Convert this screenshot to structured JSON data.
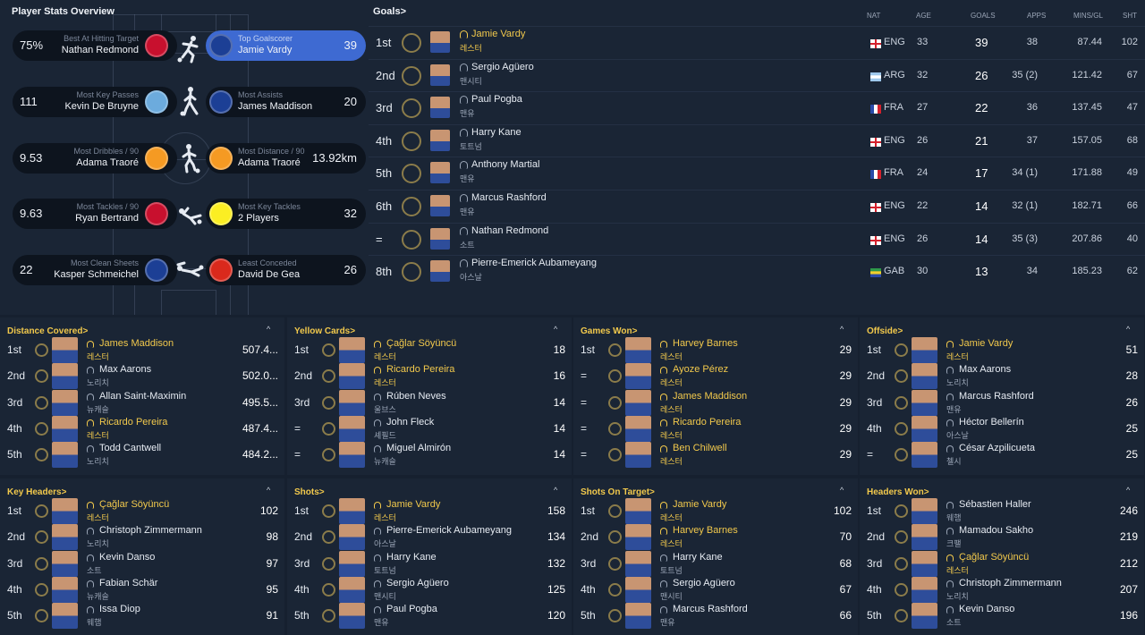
{
  "overview": {
    "title": "Player Stats Overview",
    "pills": [
      {
        "side": "left",
        "value": "75%",
        "sub": "Best At Hitting Target",
        "name": "Nathan Redmond",
        "crest": "#c8102e",
        "active": false
      },
      {
        "side": "right",
        "value": "39",
        "sub": "Top Goalscorer",
        "name": "Jamie Vardy",
        "crest": "#1c3f95",
        "active": true
      },
      {
        "side": "left",
        "value": "111",
        "sub": "Most Key Passes",
        "name": "Kevin De Bruyne",
        "crest": "#6cabdd",
        "active": false
      },
      {
        "side": "right",
        "value": "20",
        "sub": "Most Assists",
        "name": "James Maddison",
        "crest": "#1c3f95",
        "active": false
      },
      {
        "side": "left",
        "value": "9.53",
        "sub": "Most Dribbles / 90",
        "name": "Adama Traoré",
        "crest": "#f59a23",
        "active": false
      },
      {
        "side": "right",
        "value": "13.92km",
        "sub": "Most Distance / 90",
        "name": "Adama Traoré",
        "crest": "#f59a23",
        "active": false
      },
      {
        "side": "left",
        "value": "9.63",
        "sub": "Most Tackles / 90",
        "name": "Ryan Bertrand",
        "crest": "#c8102e",
        "active": false
      },
      {
        "side": "right",
        "value": "32",
        "sub": "Most Key Tackles",
        "name": "2 Players",
        "crest": "#fbee23",
        "active": false
      },
      {
        "side": "left",
        "value": "22",
        "sub": "Most Clean Sheets",
        "name": "Kasper Schmeichel",
        "crest": "#1c3f95",
        "active": false
      },
      {
        "side": "right",
        "value": "26",
        "sub": "Least Conceded",
        "name": "David De Gea",
        "crest": "#da291c",
        "active": false
      }
    ]
  },
  "goals": {
    "title": "Goals",
    "headers": {
      "nat": "NAT",
      "age": "AGE",
      "goals": "GOALS",
      "apps": "APPS",
      "mins": "MINS/GL",
      "sht": "SHT"
    },
    "rows": [
      {
        "pos": "1st",
        "name": "Jamie Vardy",
        "club": "레스터",
        "nat": "ENG",
        "flag": "eng",
        "age": "33",
        "goals": "39",
        "apps": "38",
        "mins": "87.44",
        "sht": "102",
        "hl": true
      },
      {
        "pos": "2nd",
        "name": "Sergio Agüero",
        "club": "맨시티",
        "nat": "ARG",
        "flag": "arg",
        "age": "32",
        "goals": "26",
        "apps": "35 (2)",
        "mins": "121.42",
        "sht": "67",
        "hl": false
      },
      {
        "pos": "3rd",
        "name": "Paul Pogba",
        "club": "맨유",
        "nat": "FRA",
        "flag": "fra",
        "age": "27",
        "goals": "22",
        "apps": "36",
        "mins": "137.45",
        "sht": "47",
        "hl": false
      },
      {
        "pos": "4th",
        "name": "Harry Kane",
        "club": "토트넘",
        "nat": "ENG",
        "flag": "eng",
        "age": "26",
        "goals": "21",
        "apps": "37",
        "mins": "157.05",
        "sht": "68",
        "hl": false
      },
      {
        "pos": "5th",
        "name": "Anthony Martial",
        "club": "맨유",
        "nat": "FRA",
        "flag": "fra",
        "age": "24",
        "goals": "17",
        "apps": "34 (1)",
        "mins": "171.88",
        "sht": "49",
        "hl": false
      },
      {
        "pos": "6th",
        "name": "Marcus Rashford",
        "club": "맨유",
        "nat": "ENG",
        "flag": "eng",
        "age": "22",
        "goals": "14",
        "apps": "32 (1)",
        "mins": "182.71",
        "sht": "66",
        "hl": false
      },
      {
        "pos": "=",
        "name": "Nathan Redmond",
        "club": "소트",
        "nat": "ENG",
        "flag": "eng",
        "age": "26",
        "goals": "14",
        "apps": "35 (3)",
        "mins": "207.86",
        "sht": "40",
        "hl": false
      },
      {
        "pos": "8th",
        "name": "Pierre-Emerick Aubameyang",
        "club": "아스날",
        "nat": "GAB",
        "flag": "gab",
        "age": "30",
        "goals": "13",
        "apps": "34",
        "mins": "185.23",
        "sht": "62",
        "hl": false
      }
    ]
  },
  "panels": [
    {
      "title": "Distance Covered",
      "rows": [
        {
          "rank": "1st",
          "name": "James Maddison",
          "club": "레스터",
          "value": "507.4...",
          "hl": true
        },
        {
          "rank": "2nd",
          "name": "Max Aarons",
          "club": "노리치",
          "value": "502.0...",
          "hl": false
        },
        {
          "rank": "3rd",
          "name": "Allan Saint-Maximin",
          "club": "뉴캐슬",
          "value": "495.5...",
          "hl": false
        },
        {
          "rank": "4th",
          "name": "Ricardo Pereira",
          "club": "레스터",
          "value": "487.4...",
          "hl": true
        },
        {
          "rank": "5th",
          "name": "Todd Cantwell",
          "club": "노리치",
          "value": "484.2...",
          "hl": false
        }
      ]
    },
    {
      "title": "Yellow Cards",
      "rows": [
        {
          "rank": "1st",
          "name": "Çağlar Söyüncü",
          "club": "레스터",
          "value": "18",
          "hl": true
        },
        {
          "rank": "2nd",
          "name": "Ricardo Pereira",
          "club": "레스터",
          "value": "16",
          "hl": true
        },
        {
          "rank": "3rd",
          "name": "Rúben Neves",
          "club": "울브스",
          "value": "14",
          "hl": false
        },
        {
          "rank": "=",
          "name": "John Fleck",
          "club": "셰필드",
          "value": "14",
          "hl": false
        },
        {
          "rank": "=",
          "name": "Miguel Almirón",
          "club": "뉴캐슬",
          "value": "14",
          "hl": false
        }
      ]
    },
    {
      "title": "Games Won",
      "rows": [
        {
          "rank": "1st",
          "name": "Harvey Barnes",
          "club": "레스터",
          "value": "29",
          "hl": true
        },
        {
          "rank": "=",
          "name": "Ayoze Pérez",
          "club": "레스터",
          "value": "29",
          "hl": true
        },
        {
          "rank": "=",
          "name": "James Maddison",
          "club": "레스터",
          "value": "29",
          "hl": true
        },
        {
          "rank": "=",
          "name": "Ricardo Pereira",
          "club": "레스터",
          "value": "29",
          "hl": true
        },
        {
          "rank": "=",
          "name": "Ben Chilwell",
          "club": "레스터",
          "value": "29",
          "hl": true
        }
      ]
    },
    {
      "title": "Offside",
      "rows": [
        {
          "rank": "1st",
          "name": "Jamie Vardy",
          "club": "레스터",
          "value": "51",
          "hl": true
        },
        {
          "rank": "2nd",
          "name": "Max Aarons",
          "club": "노리치",
          "value": "28",
          "hl": false
        },
        {
          "rank": "3rd",
          "name": "Marcus Rashford",
          "club": "맨유",
          "value": "26",
          "hl": false
        },
        {
          "rank": "4th",
          "name": "Héctor Bellerín",
          "club": "아스날",
          "value": "25",
          "hl": false
        },
        {
          "rank": "=",
          "name": "César Azpilicueta",
          "club": "첼시",
          "value": "25",
          "hl": false
        }
      ]
    },
    {
      "title": "Key Headers",
      "rows": [
        {
          "rank": "1st",
          "name": "Çağlar Söyüncü",
          "club": "레스터",
          "value": "102",
          "hl": true
        },
        {
          "rank": "2nd",
          "name": "Christoph Zimmermann",
          "club": "노리치",
          "value": "98",
          "hl": false
        },
        {
          "rank": "3rd",
          "name": "Kevin Danso",
          "club": "소트",
          "value": "97",
          "hl": false
        },
        {
          "rank": "4th",
          "name": "Fabian Schär",
          "club": "뉴캐슬",
          "value": "95",
          "hl": false
        },
        {
          "rank": "5th",
          "name": "Issa Diop",
          "club": "웨햄",
          "value": "91",
          "hl": false
        }
      ]
    },
    {
      "title": "Shots",
      "rows": [
        {
          "rank": "1st",
          "name": "Jamie Vardy",
          "club": "레스터",
          "value": "158",
          "hl": true
        },
        {
          "rank": "2nd",
          "name": "Pierre-Emerick Aubameyang",
          "club": "아스날",
          "value": "134",
          "hl": false
        },
        {
          "rank": "3rd",
          "name": "Harry Kane",
          "club": "토트넘",
          "value": "132",
          "hl": false
        },
        {
          "rank": "4th",
          "name": "Sergio Agüero",
          "club": "맨시티",
          "value": "125",
          "hl": false
        },
        {
          "rank": "5th",
          "name": "Paul Pogba",
          "club": "맨유",
          "value": "120",
          "hl": false
        }
      ]
    },
    {
      "title": "Shots On Target",
      "rows": [
        {
          "rank": "1st",
          "name": "Jamie Vardy",
          "club": "레스터",
          "value": "102",
          "hl": true
        },
        {
          "rank": "2nd",
          "name": "Harvey Barnes",
          "club": "레스터",
          "value": "70",
          "hl": true
        },
        {
          "rank": "3rd",
          "name": "Harry Kane",
          "club": "토트넘",
          "value": "68",
          "hl": false
        },
        {
          "rank": "4th",
          "name": "Sergio Agüero",
          "club": "맨시티",
          "value": "67",
          "hl": false
        },
        {
          "rank": "5th",
          "name": "Marcus Rashford",
          "club": "맨유",
          "value": "66",
          "hl": false
        }
      ]
    },
    {
      "title": "Headers Won",
      "rows": [
        {
          "rank": "1st",
          "name": "Sébastien Haller",
          "club": "웨햄",
          "value": "246",
          "hl": false
        },
        {
          "rank": "2nd",
          "name": "Mamadou Sakho",
          "club": "크팰",
          "value": "219",
          "hl": false
        },
        {
          "rank": "3rd",
          "name": "Çağlar Söyüncü",
          "club": "레스터",
          "value": "212",
          "hl": true
        },
        {
          "rank": "4th",
          "name": "Christoph Zimmermann",
          "club": "노리치",
          "value": "207",
          "hl": false
        },
        {
          "rank": "5th",
          "name": "Kevin Danso",
          "club": "소트",
          "value": "196",
          "hl": false
        }
      ]
    }
  ],
  "colors": {
    "highlight": "#f2c94c",
    "active_pill": "#3e6ad2",
    "panel_bg": "#1a2535"
  },
  "icons": {
    "title_arrow": ">",
    "collapse": "^"
  }
}
